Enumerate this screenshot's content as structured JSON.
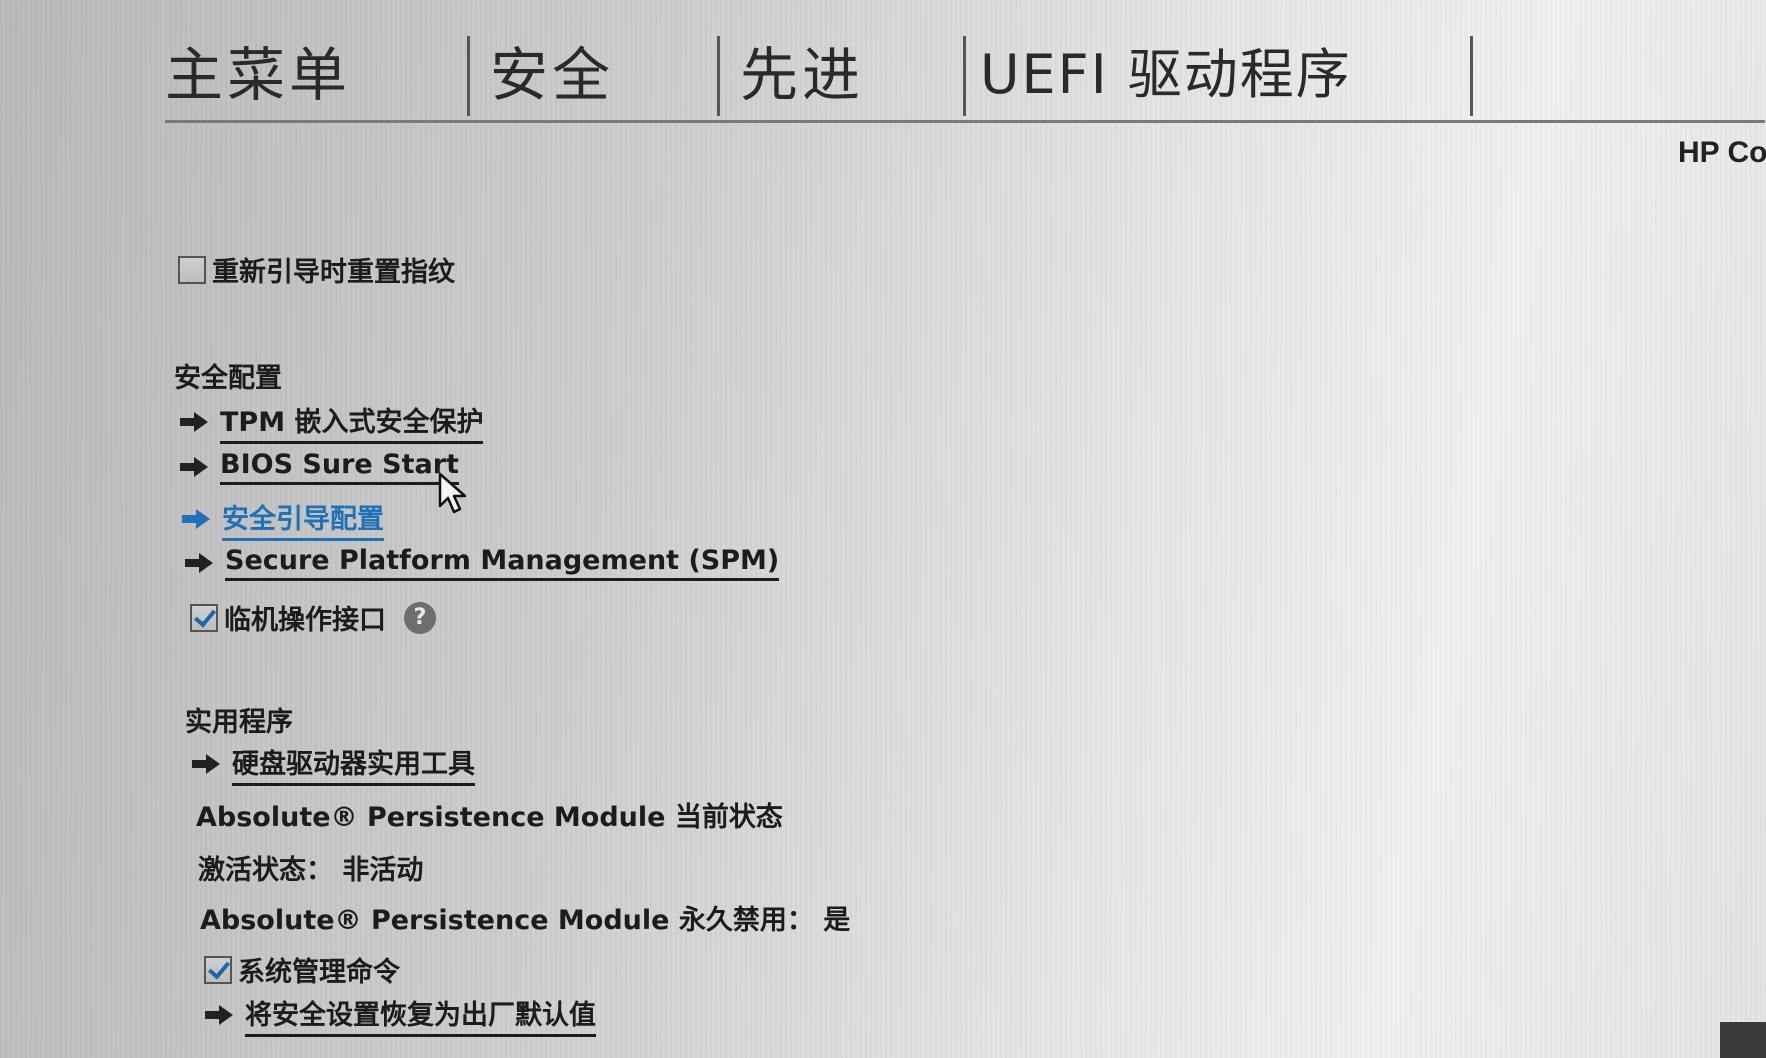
{
  "menu": {
    "tabs": [
      {
        "label": "主菜单"
      },
      {
        "label": "安全"
      },
      {
        "label": "先进"
      },
      {
        "label": "UEFI 驱动程序"
      }
    ]
  },
  "brand": "HP Co",
  "reset_fingerprint": {
    "label": "重新引导时重置指纹",
    "checked": false
  },
  "security_config": {
    "title": "安全配置",
    "items": [
      {
        "label": "TPM 嵌入式安全保护"
      },
      {
        "label": "BIOS Sure Start"
      },
      {
        "label": "安全引导配置",
        "active": true
      },
      {
        "label": "Secure Platform Management (SPM)"
      }
    ],
    "physical_presence": {
      "label": "临机操作接口",
      "checked": true,
      "help": "?"
    }
  },
  "utilities": {
    "title": "实用程序",
    "hdd_tools": {
      "label": "硬盘驱动器实用工具"
    },
    "absolute_status_label": "Absolute® Persistence Module 当前状态",
    "activation_state": "激活状态： 非活动",
    "absolute_permanent_disable": "Absolute® Persistence Module 永久禁用： 是",
    "system_mgmt_command": {
      "label": "系统管理命令",
      "checked": true
    },
    "restore_defaults": {
      "label": "将安全设置恢复为出厂默认值"
    }
  },
  "colors": {
    "accent": "#1f72b8",
    "text": "#1c1c1c"
  }
}
